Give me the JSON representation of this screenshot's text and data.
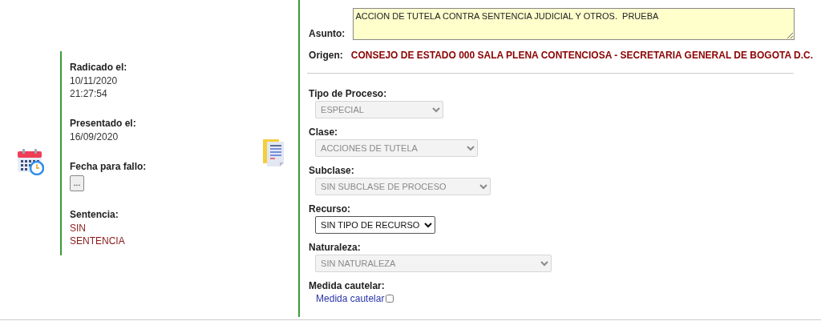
{
  "dates_panel": {
    "fields": [
      {
        "kind": "text",
        "label": "Radicado el:",
        "lines": [
          "10/11/2020",
          "21:27:54"
        ]
      },
      {
        "kind": "text",
        "label": "Presentado el:",
        "lines": [
          "16/09/2020"
        ]
      },
      {
        "kind": "button",
        "label": "Fecha para fallo:",
        "button": "..."
      },
      {
        "kind": "status",
        "label": "Sentencia:",
        "lines": [
          "SIN",
          "SENTENCIA"
        ]
      }
    ]
  },
  "subject": {
    "label": "Asunto:",
    "value": "ACCION DE TUTELA CONTRA SENTENCIA JUDICIAL Y OTROS.  PRUEBA"
  },
  "origin": {
    "label": "Origen:",
    "value": "CONSEJO DE ESTADO 000 SALA PLENA CONTENCIOSA - SECRETARIA GENERAL DE BOGOTA D.C."
  },
  "process_fields": [
    {
      "label": "Tipo de Proceso:",
      "value": "ESPECIAL",
      "disabled": true
    },
    {
      "label": "Clase:",
      "value": "ACCIONES DE TUTELA",
      "disabled": true
    },
    {
      "label": "Subclase:",
      "value": "SIN SUBCLASE DE PROCESO",
      "disabled": true
    },
    {
      "label": "Recurso:",
      "value": "SIN TIPO DE RECURSO",
      "disabled": false
    },
    {
      "label": "Naturaleza:",
      "value": "SIN NATURALEZA",
      "disabled": true
    }
  ],
  "precautionary": {
    "label": "Medida cautelar:",
    "link": "Medida cautelar",
    "checked": false
  }
}
